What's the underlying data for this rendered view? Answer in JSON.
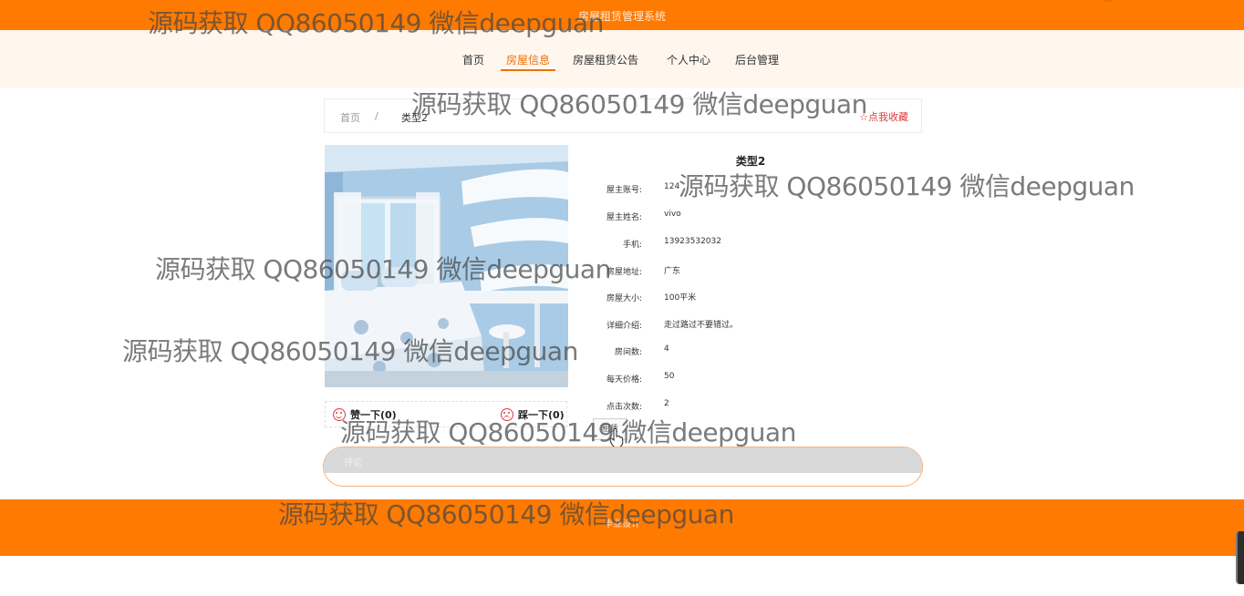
{
  "header": {
    "system_title": "房屋租赁管理系统"
  },
  "nav": {
    "items": [
      {
        "label": "首页"
      },
      {
        "label": "房屋信息"
      },
      {
        "label": "房屋租赁公告"
      },
      {
        "label": "个人中心"
      },
      {
        "label": "后台管理"
      }
    ],
    "active_index": 1
  },
  "breadcrumb": {
    "home": "首页",
    "separator": "/",
    "current": "类型2"
  },
  "favorite": {
    "label": "☆点我收藏"
  },
  "detail": {
    "title": "类型2",
    "rows": [
      {
        "label": "屋主账号:",
        "value": "124"
      },
      {
        "label": "屋主姓名:",
        "value": "vivo"
      },
      {
        "label": "手机:",
        "value": "13923532032"
      },
      {
        "label": "房屋地址:",
        "value": "广东"
      },
      {
        "label": "房屋大小:",
        "value": "100平米"
      },
      {
        "label": "详细介绍:",
        "value": "走过路过不要错过。"
      },
      {
        "label": "房间数:",
        "value": "4"
      },
      {
        "label": "每天价格:",
        "value": "50"
      },
      {
        "label": "点击次数:",
        "value": "2"
      }
    ]
  },
  "votes": {
    "like_label": "赞一下(0)",
    "dislike_label": "踩一下(0)"
  },
  "action": {
    "book_label": "租赁"
  },
  "comment": {
    "header_label": "评论"
  },
  "footer": {
    "credit": "毕业设计"
  },
  "watermark": {
    "text": "源码获取 QQ86050149 微信deepguan"
  },
  "colors": {
    "brand": "#ff7a00",
    "accent": "#e8730c",
    "favorite": "#e03a3a",
    "nav_bg": "#fff6ee"
  }
}
